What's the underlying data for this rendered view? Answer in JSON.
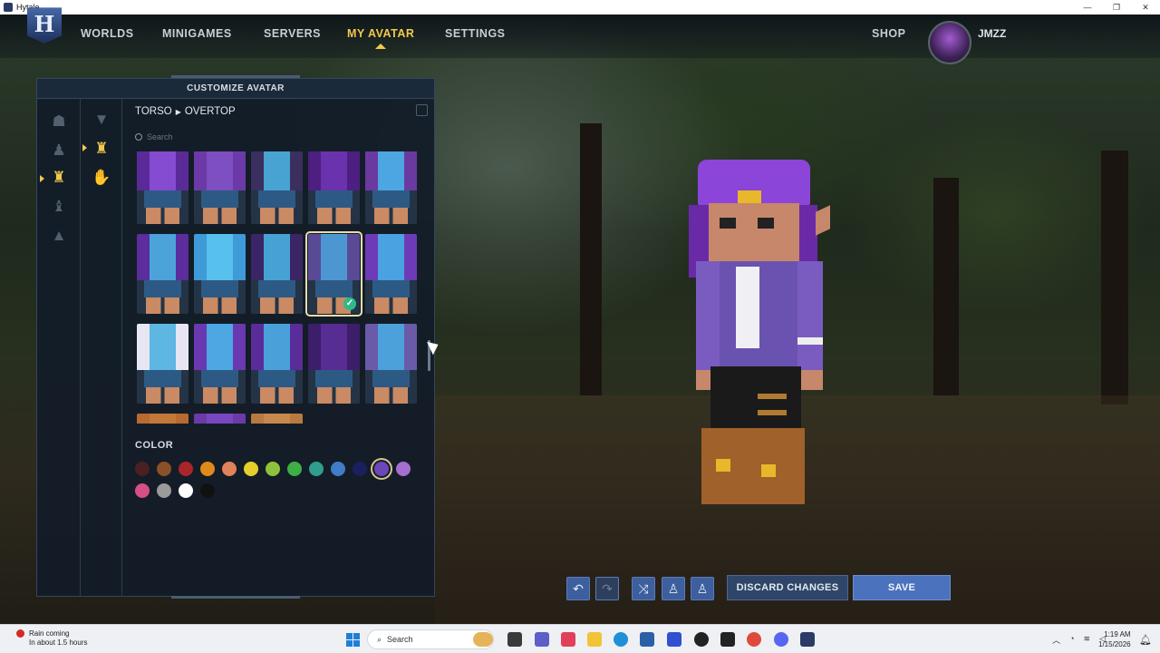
{
  "window": {
    "title": "Hytale",
    "controls": [
      "—",
      "❐",
      "✕"
    ]
  },
  "nav": {
    "logo_letter": "H",
    "items": [
      "WORLDS",
      "MINIGAMES",
      "SERVERS",
      "MY AVATAR",
      "SETTINGS"
    ],
    "active": "MY AVATAR",
    "shop": "SHOP",
    "username": "JMZZ"
  },
  "panel": {
    "title": "CUSTOMIZE AVATAR",
    "breadcrumb": {
      "category": "TORSO",
      "separator": "▶",
      "subcategory": "OVERTOP"
    },
    "search_placeholder": "Search",
    "category_icons": [
      "head-icon",
      "body-icon",
      "torso-icon",
      "legs-icon",
      "feet-icon"
    ],
    "subcategory_icons": [
      "shirt-icon",
      "overtop-icon",
      "gloves-icon"
    ],
    "items": [
      {
        "top": "#5a2a99",
        "mid": "#8a4fd6",
        "selected": false
      },
      {
        "top": "#6b3aa8",
        "mid": "#7f52c2",
        "selected": false
      },
      {
        "top": "#3a2f5e",
        "mid": "#4ab0e0",
        "selected": false
      },
      {
        "top": "#4d1f80",
        "mid": "#6e34b0",
        "selected": false
      },
      {
        "top": "#6a3aa0",
        "mid": "#49b3e8",
        "selected": false
      },
      {
        "top": "#5c2d9c",
        "mid": "#49b0e0",
        "selected": false
      },
      {
        "top": "#3f9ad8",
        "mid": "#5ac4f0",
        "selected": false
      },
      {
        "top": "#3a2566",
        "mid": "#49b0e0",
        "selected": false
      },
      {
        "top": "#5a4a96",
        "mid": "#4aa0d8",
        "selected": true
      },
      {
        "top": "#6d3bb8",
        "mid": "#46aee6",
        "selected": false
      },
      {
        "top": "#e8e6f2",
        "mid": "#4fb0e0",
        "selected": false
      },
      {
        "top": "#6a38b0",
        "mid": "#49b4e8",
        "selected": false
      },
      {
        "top": "#5a2c9a",
        "mid": "#48aee0",
        "selected": false
      },
      {
        "top": "#3c1e6a",
        "mid": "#5a2e98",
        "selected": false
      },
      {
        "top": "#6a5aa8",
        "mid": "#4aa8e0",
        "selected": false
      },
      {
        "top": "#b86a30",
        "mid": "#c47a3a",
        "selected": false
      },
      {
        "top": "#6b3aa8",
        "mid": "#7a4ac4",
        "selected": false
      },
      {
        "top": "#b87a40",
        "mid": "#c98a50",
        "selected": false
      }
    ],
    "color_title": "COLOR",
    "colors": [
      "#4a2022",
      "#8a5128",
      "#a8262a",
      "#e08a1c",
      "#e0825a",
      "#e6cf2a",
      "#8fc23a",
      "#3fae46",
      "#2f9e8f",
      "#3f7dc7",
      "#1a1f5e",
      "#6b47b8",
      "#a66ed0",
      "#d64f86",
      "#9a9a9a",
      "#ffffff",
      "#111111"
    ],
    "selected_color": 11
  },
  "toolbar": {
    "undo_icon": "↶",
    "redo_icon": "↷",
    "randomize_icon": "⤨",
    "discard_label": "DISCARD CHANGES",
    "save_label": "SAVE"
  },
  "taskbar": {
    "weather_title": "Rain coming",
    "weather_sub": "In about 1.5 hours",
    "search_label": "Search",
    "time": "1:19 AM",
    "date": "1/15/2026"
  }
}
